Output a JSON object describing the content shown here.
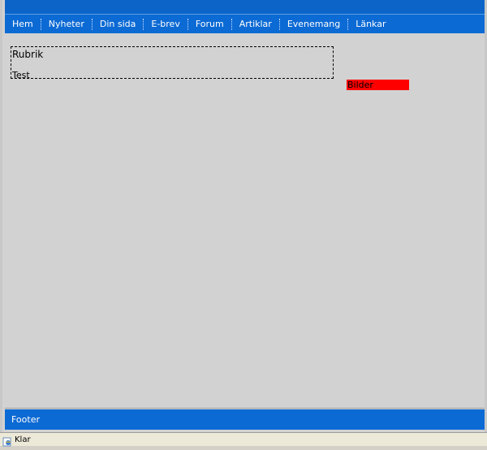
{
  "colors": {
    "header_blue": "#0c64c8",
    "nav_blue": "#0c6ad4",
    "page_bg": "#d2d2d2",
    "side_block_red": "#ff0000"
  },
  "nav": {
    "items": [
      {
        "label": "Hem"
      },
      {
        "label": "Nyheter"
      },
      {
        "label": "Din sida"
      },
      {
        "label": "E-brev"
      },
      {
        "label": "Forum"
      },
      {
        "label": "Artiklar"
      },
      {
        "label": "Evenemang"
      },
      {
        "label": "Länkar"
      }
    ]
  },
  "content": {
    "title": "Rubrik",
    "text": "Test"
  },
  "sidebar": {
    "label": "Bilder"
  },
  "footer": {
    "text": "Footer"
  },
  "statusbar": {
    "icon": "ie-page-icon",
    "text": "Klar"
  }
}
